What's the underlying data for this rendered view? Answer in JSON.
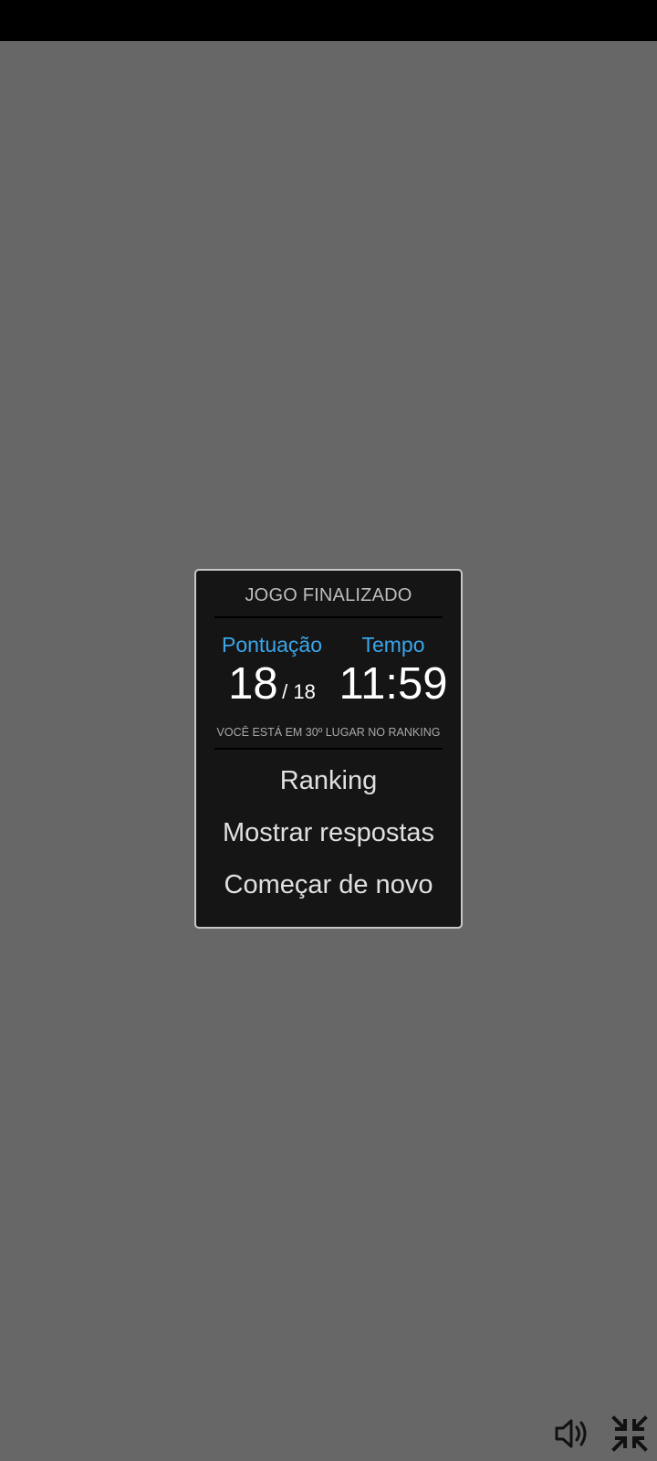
{
  "dialog": {
    "title": "JOGO FINALIZADO",
    "score_label": "Pontuação",
    "time_label": "Tempo",
    "score": "18",
    "score_separator": "/ 18",
    "time": "11:59",
    "ranking_note": "VOCÊ ESTÁ EM 30º LUGAR NO RANKING"
  },
  "menu": {
    "ranking": "Ranking",
    "show_answers": "Mostrar respostas",
    "restart": "Começar de novo"
  },
  "controls": {
    "sound_icon": "speaker-volume-icon",
    "collapse_icon": "exit-fullscreen-icon"
  },
  "colors": {
    "overlay": "#676767",
    "dialog_bg": "#151515",
    "label_accent": "#3aa6ea"
  }
}
